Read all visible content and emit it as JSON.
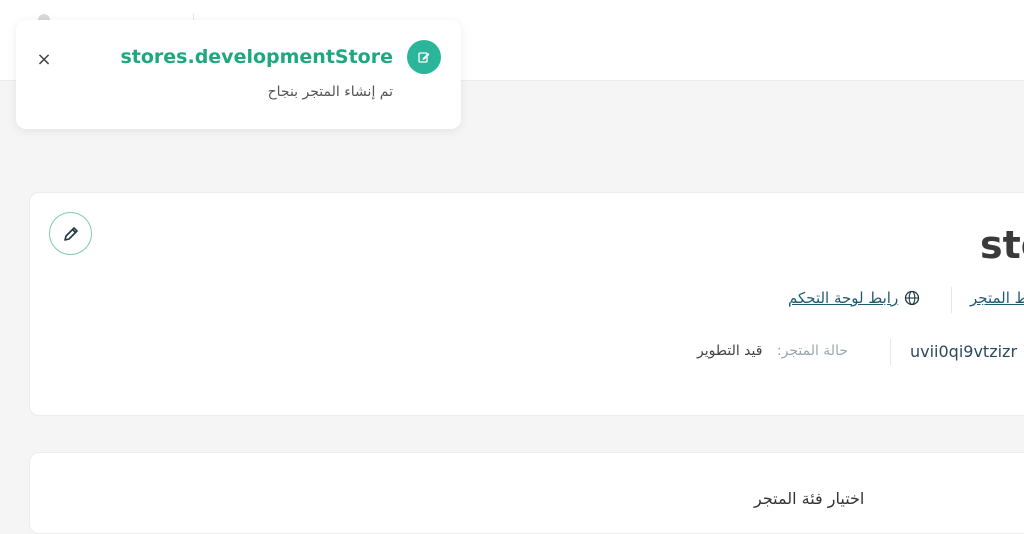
{
  "toast": {
    "title": "stores.developmentStore",
    "message": "تم إنشاء المتجر بنجاح",
    "close_symbol": "×",
    "icon": "edit-note-icon"
  },
  "store": {
    "name": "sto",
    "store_link_label": "ط المتجر",
    "dashboard_link_label": "رابط لوحة التحكم",
    "store_id": "uvii0qi9vtzizr",
    "status_label": "حالة المتجر:",
    "status_value": "قيد التطوير"
  },
  "category": {
    "title": "اختيار فئة المتجر"
  },
  "colors": {
    "accent": "#2bb59a",
    "toast_title": "#1fa87e",
    "link": "#1f5a70"
  }
}
